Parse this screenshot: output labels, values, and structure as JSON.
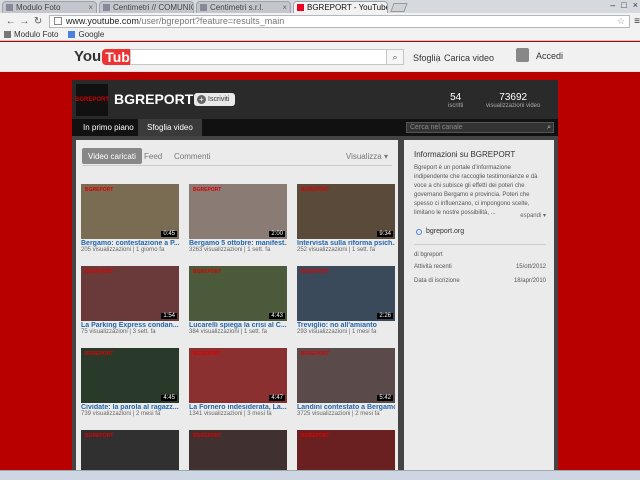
{
  "browser": {
    "tabs": [
      {
        "title": "Modulo Foto"
      },
      {
        "title": "Centimetri // COMUNICA"
      },
      {
        "title": "Centimetri s.r.l."
      },
      {
        "title": "BGREPORT - YouTube"
      }
    ],
    "url_domain": "www.youtube.com",
    "url_path": "/user/bgreport?feature=results_main",
    "bookmarks": [
      "Modulo Foto",
      "Google"
    ]
  },
  "youtube": {
    "logo_you": "You",
    "logo_tube": "Tube",
    "search_placeholder": "",
    "sfoglia": "Sfoglia",
    "carica": "Carica video",
    "accedi": "Accedi"
  },
  "channel": {
    "name": "BGREPORT",
    "logo_text": "BGREPORT",
    "subscribe": "Iscriviti",
    "stats": [
      {
        "value": "54",
        "label": "iscritti"
      },
      {
        "value": "73692",
        "label": "visualizzazioni video"
      }
    ],
    "tabs": [
      "In primo piano",
      "Sfoglia video"
    ],
    "search_placeholder": "Cerca nel canale",
    "subtabs": [
      "Video caricati",
      "Feed",
      "Commenti"
    ],
    "sort": "Visualizza"
  },
  "videos": [
    {
      "title": "Bergamo: contestazione a P...",
      "views": "205 visualizzazioni",
      "age": "1 giorno fa",
      "duration": "0:45"
    },
    {
      "title": "Bergamo 5 ottobre: manifest...",
      "views": "3263 visualizzazioni",
      "age": "1 sett. fa",
      "duration": "2:00"
    },
    {
      "title": "Intervista sulla riforma psich...",
      "views": "252 visualizzazioni",
      "age": "1 sett. fa",
      "duration": "9:34"
    },
    {
      "title": "La Parking Express condan...",
      "views": "75 visualizzazioni",
      "age": "3 sett. fa",
      "duration": "1:54"
    },
    {
      "title": "Lucarelli spiega la crisi al C...",
      "views": "384 visualizzazioni",
      "age": "1 sett. fa",
      "duration": "4:43"
    },
    {
      "title": "Treviglio: no all'amianto",
      "views": "293 visualizzazioni",
      "age": "1 mesi fa",
      "duration": "2:26"
    },
    {
      "title": "Cividate: la parola al ragazz...",
      "views": "739 visualizzazioni",
      "age": "2 mesi fa",
      "duration": "4:45"
    },
    {
      "title": "La Fornero indesiderata, La...",
      "views": "1341 visualizzazioni",
      "age": "3 mesi fa",
      "duration": "4:47"
    },
    {
      "title": "Landini contestato a Bergamo",
      "views": "3725 visualizzazioni",
      "age": "2 mesi fa",
      "duration": "5:42"
    },
    {
      "title": "",
      "views": "",
      "age": "",
      "duration": ""
    },
    {
      "title": "",
      "views": "",
      "age": "",
      "duration": ""
    },
    {
      "title": "",
      "views": "",
      "age": "",
      "duration": ""
    }
  ],
  "about": {
    "heading": "Informazioni su BGREPORT",
    "description": "Bgreport è un portale d'informazione indipendente che raccoglie testimonianze e dà voce a chi subisce gli effetti dei poteri che governano Bergamo e provincia. Poteri che spesso ci influenzano, ci impongono scelte, limitano le nostre possibilità, ...",
    "expand": "espandi",
    "link": "bgreport.org",
    "rows": [
      {
        "key": "di bgreport",
        "value": ""
      },
      {
        "key": "Attività recenti",
        "value": "15/ott/2012"
      },
      {
        "key": "Data di iscrizione",
        "value": "18/apr/2010"
      }
    ]
  },
  "thumb_colors": [
    "#7a6c52",
    "#8a7b74",
    "#5a4a3a",
    "#6a3a3a",
    "#4a5a3a",
    "#3a4a5a",
    "#2a3a2a",
    "#8a3030",
    "#5a4a4a",
    "#303030",
    "#403030",
    "#6a2020"
  ]
}
